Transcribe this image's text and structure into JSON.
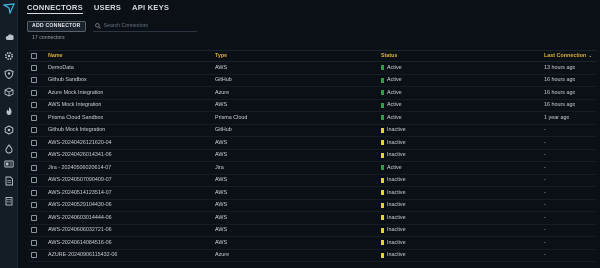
{
  "colors": {
    "active": "#2ea043",
    "inactive": "#e7d23b",
    "header": "#d8b13a",
    "background": "#0b0f16"
  },
  "sidebar": {
    "logo": "logo-icon",
    "items": [
      {
        "icon": "cloud-icon"
      },
      {
        "icon": "gear-icon"
      },
      {
        "icon": "user-shield-icon"
      },
      {
        "icon": "cube-icon"
      },
      {
        "icon": "flame-icon"
      },
      {
        "icon": "hexagon-icon"
      },
      {
        "icon": "droplet-icon"
      },
      {
        "icon": "id-card-icon"
      },
      {
        "icon": "document-icon"
      },
      {
        "icon": "building-icon"
      }
    ]
  },
  "tabs": [
    {
      "label": "CONNECTORS",
      "active": true
    },
    {
      "label": "USERS",
      "active": false
    },
    {
      "label": "API KEYS",
      "active": false
    }
  ],
  "toolbar": {
    "add_label": "ADD CONNECTOR",
    "search_placeholder": "Search Connectors",
    "search_icon": "search-icon"
  },
  "count_label": "17 connectors",
  "table": {
    "headers": {
      "name": "Name",
      "type": "Type",
      "status": "Status",
      "last": "Last Connection"
    },
    "sort_indicator": "⌄",
    "rows": [
      {
        "name": "DemoData",
        "type": "AWS",
        "status": "Active",
        "last": "13 hours ago"
      },
      {
        "name": "Github Sandbox",
        "type": "GitHub",
        "status": "Active",
        "last": "16 hours ago"
      },
      {
        "name": "Azure Mock Integration",
        "type": "Azure",
        "status": "Active",
        "last": "16 hours ago"
      },
      {
        "name": "AWS Mock Integration",
        "type": "AWS",
        "status": "Active",
        "last": "16 hours ago"
      },
      {
        "name": "Prisma Cloud Sandbox",
        "type": "Prisma Cloud",
        "status": "Active",
        "last": "1 year ago"
      },
      {
        "name": "Github Mock Integration",
        "type": "GitHub",
        "status": "Inactive",
        "last": "-"
      },
      {
        "name": "AWS-20240426121620-04",
        "type": "AWS",
        "status": "Inactive",
        "last": "-"
      },
      {
        "name": "AWS-20240426014341-06",
        "type": "AWS",
        "status": "Inactive",
        "last": "-"
      },
      {
        "name": "Jira - 20240506020614-07",
        "type": "Jira",
        "status": "Active",
        "last": "-"
      },
      {
        "name": "AWS-20240507090409-07",
        "type": "AWS",
        "status": "Inactive",
        "last": "-"
      },
      {
        "name": "AWS-20240514123514-07",
        "type": "AWS",
        "status": "Inactive",
        "last": "-"
      },
      {
        "name": "AWS-20240529104430-06",
        "type": "AWS",
        "status": "Inactive",
        "last": "-"
      },
      {
        "name": "AWS-20240603014444-06",
        "type": "AWS",
        "status": "Inactive",
        "last": "-"
      },
      {
        "name": "AWS-20240606032721-06",
        "type": "AWS",
        "status": "Inactive",
        "last": "-"
      },
      {
        "name": "AWS-20240614084516-06",
        "type": "AWS",
        "status": "Inactive",
        "last": "-"
      },
      {
        "name": "AZURE-20240906115432-06",
        "type": "Azure",
        "status": "Inactive",
        "last": "-"
      }
    ]
  }
}
